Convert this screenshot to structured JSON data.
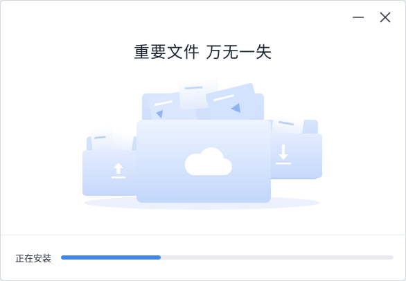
{
  "window": {
    "headline": "重要文件 万无一失",
    "controls": {
      "minimize_icon": "minus-icon",
      "close_icon": "x-icon"
    }
  },
  "illustration": {
    "icons": [
      "folder-upload-icon",
      "folder-cloud-icon",
      "folder-download-icon",
      "cloud-icon"
    ]
  },
  "install": {
    "status_text": "正在安装",
    "progress_fraction": 0.3
  },
  "colors": {
    "accent": "#3f86f2",
    "track": "#e7e9ee",
    "folder_light": "#eaf1ff",
    "folder_mid": "#bcd3fb",
    "text": "#1f2633"
  }
}
